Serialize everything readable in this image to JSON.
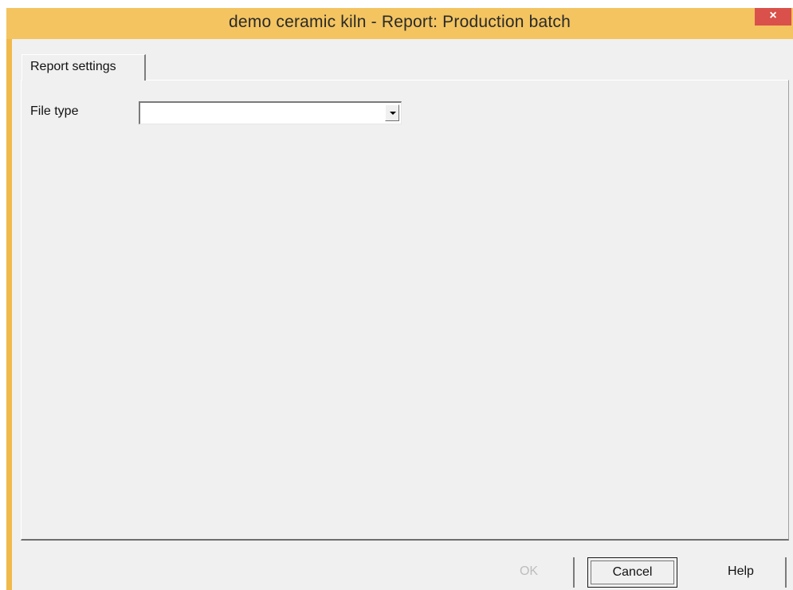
{
  "window": {
    "title": "demo ceramic kiln - Report: Production batch",
    "close_label": "×"
  },
  "tabs": [
    {
      "label": "Report settings",
      "selected": true
    }
  ],
  "form": {
    "file_type_label": "File type",
    "file_type_value": ""
  },
  "buttons": {
    "ok": "OK",
    "ok_enabled": false,
    "cancel": "Cancel",
    "help": "Help"
  },
  "colors": {
    "titlebar": "#f3c460",
    "close": "#d9514a",
    "face": "#f0f0f0"
  },
  "icons": {
    "close": "close-icon",
    "dropdown": "chevron-down-icon"
  }
}
